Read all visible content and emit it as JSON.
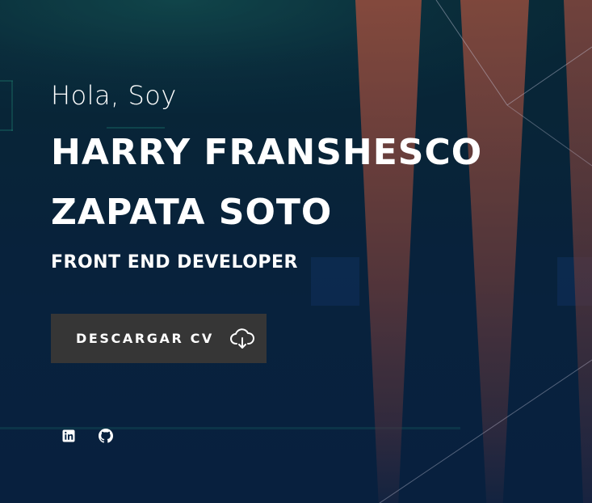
{
  "hero": {
    "greeting": "Hola, Soy",
    "name_line_1": "HARRY FRANSHESCO",
    "name_line_2": "ZAPATA SOTO",
    "role": "FRONT END DEVELOPER",
    "cv_button_label": "DESCARGAR CV",
    "cv_button_icon": "cloud-download-icon"
  },
  "social": {
    "items": [
      {
        "icon": "linkedin-icon"
      },
      {
        "icon": "github-icon"
      }
    ]
  },
  "colors": {
    "button_background": "#363636",
    "text": "#ffffff",
    "background_dark": "#0a2746",
    "beam": "#be5f46"
  }
}
